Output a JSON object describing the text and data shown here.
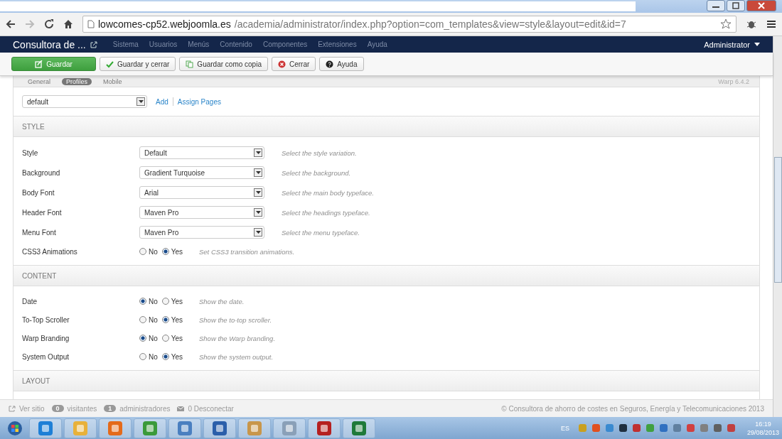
{
  "browser": {
    "url_host": "lowcomes-cp52.webjoomla.es",
    "url_path": "/academia/administrator/index.php?option=com_templates&view=style&layout=edit&id=7"
  },
  "navbar": {
    "site": "Consultora de ...",
    "menu": [
      "Sistema",
      "Usuarios",
      "Menús",
      "Contenido",
      "Componentes",
      "Extensiones",
      "Ayuda"
    ],
    "user": "Administrator"
  },
  "toolbar": [
    {
      "label": "Guardar",
      "kind": "primary"
    },
    {
      "label": "Guardar y cerrar",
      "kind": "check"
    },
    {
      "label": "Guardar como copia",
      "kind": "copy"
    },
    {
      "label": "Cerrar",
      "kind": "close"
    },
    {
      "label": "Ayuda",
      "kind": "help"
    }
  ],
  "tabs": [
    {
      "label": "General",
      "selected": false
    },
    {
      "label": "Profiles",
      "selected": true
    },
    {
      "label": "Mobile",
      "selected": false
    }
  ],
  "version": "Warp 6.4.2",
  "profile": {
    "value": "default",
    "links": [
      "Add",
      "Assign Pages"
    ]
  },
  "sections": [
    {
      "title": "STYLE",
      "fields": [
        {
          "kind": "select",
          "label": "Style",
          "value": "Default",
          "hint": "Select the style variation."
        },
        {
          "kind": "select",
          "label": "Background",
          "value": "Gradient Turquoise",
          "hint": "Select the background."
        },
        {
          "kind": "select",
          "label": "Body Font",
          "value": "Arial",
          "hint": "Select the main body typeface."
        },
        {
          "kind": "select",
          "label": "Header Font",
          "value": "Maven Pro",
          "hint": "Select the headings typeface."
        },
        {
          "kind": "select",
          "label": "Menu Font",
          "value": "Maven Pro",
          "hint": "Select the menu typeface."
        },
        {
          "kind": "radio",
          "label": "CSS3 Animations",
          "options": [
            {
              "label": "No",
              "selected": false
            },
            {
              "label": "Yes",
              "selected": true
            }
          ],
          "hint": "Set CSS3 transition animations."
        }
      ]
    },
    {
      "title": "CONTENT",
      "fields": [
        {
          "kind": "radio",
          "label": "Date",
          "options": [
            {
              "label": "No",
              "selected": true
            },
            {
              "label": "Yes",
              "selected": false
            }
          ],
          "hint": "Show the date."
        },
        {
          "kind": "radio",
          "label": "To-Top Scroller",
          "options": [
            {
              "label": "No",
              "selected": false
            },
            {
              "label": "Yes",
              "selected": true
            }
          ],
          "hint": "Show the to-top scroller."
        },
        {
          "kind": "radio",
          "label": "Warp Branding",
          "options": [
            {
              "label": "No",
              "selected": true
            },
            {
              "label": "Yes",
              "selected": false
            }
          ],
          "hint": "Show the Warp branding."
        },
        {
          "kind": "radio",
          "label": "System Output",
          "options": [
            {
              "label": "No",
              "selected": false
            },
            {
              "label": "Yes",
              "selected": true
            }
          ],
          "hint": "Show the system output."
        }
      ]
    },
    {
      "title": "LAYOUT"
    }
  ],
  "footer": {
    "view_site": "Ver sitio",
    "visitors_count": "0",
    "visitors": "visitantes",
    "admins_count": "1",
    "admins": "administradores",
    "logout": "0 Desconectar",
    "copyright": "© Consultora de ahorro de costes en Seguros, Energía y Telecomunicaciones 2013"
  },
  "taskbar": {
    "language": "ES",
    "time": "16:19",
    "date": "29/08/2013"
  }
}
